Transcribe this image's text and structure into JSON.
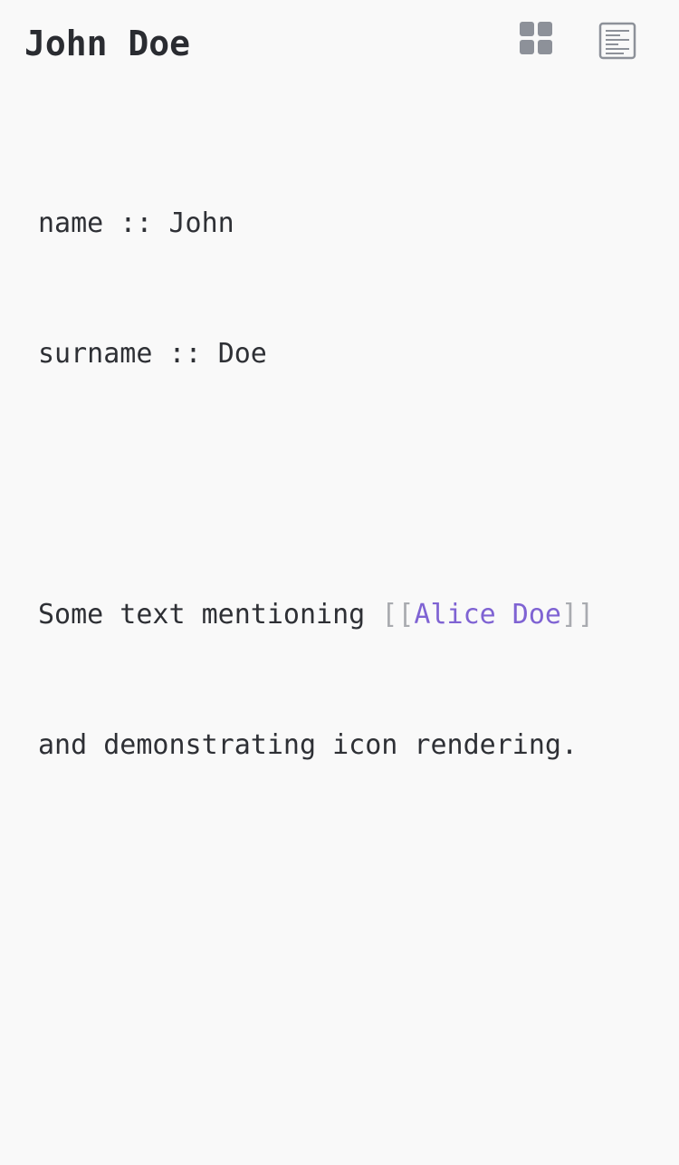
{
  "page": {
    "title": "John Doe"
  },
  "toolbar": {
    "grid_icon": "grid-view-icon",
    "text_icon": "document-text-icon",
    "icon_color": "#8d9199"
  },
  "note": {
    "properties": [
      {
        "key": "name",
        "separator": "::",
        "value": "John"
      },
      {
        "key": "surname",
        "separator": "::",
        "value": "Doe"
      }
    ],
    "paragraph": {
      "before_link": "Some text mentioning ",
      "link_open": "[[",
      "link_text": "Alice Doe",
      "link_close": "]]",
      "after_link": "and demonstrating icon rendering."
    }
  },
  "colors": {
    "background": "#f9f9f9",
    "text": "#2e3035",
    "link": "#7f63d3",
    "bracket": "#a9abb0"
  }
}
